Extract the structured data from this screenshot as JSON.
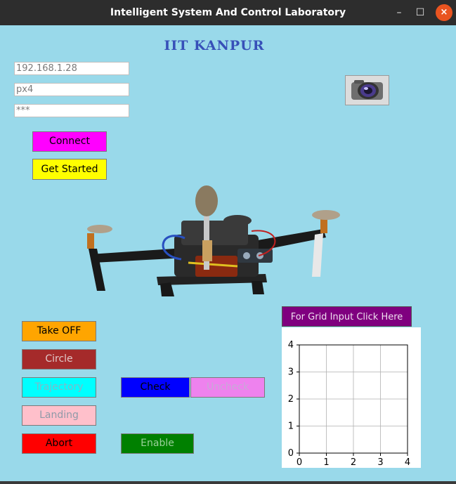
{
  "window": {
    "title": "Intelligent System And Control Laboratory"
  },
  "window_controls": {
    "minimize": "–",
    "maximize": "☐",
    "close": "×"
  },
  "heading": "IIT  KANPUR",
  "connection": {
    "ip": "192.168.1.28",
    "vehicle": "px4",
    "password": "***"
  },
  "buttons": {
    "connect": "Connect",
    "get_started": "Get Started",
    "take_off": "Take OFF",
    "circle": "Circle",
    "trajectory": "Trajectory",
    "check": "Check",
    "uncheck": "Uncheck",
    "landing": "Landing",
    "abort": "Abort",
    "enable": "Enable",
    "grid_input": "For Grid Input Click Here"
  },
  "colors": {
    "window_bg": "#99d9ea",
    "connect": "#ff00ff",
    "get_started": "#ffff00",
    "take_off": "#ffa500",
    "circle": "#a52a2a",
    "trajectory": "#00ffff",
    "check": "#0000ff",
    "uncheck": "#ee82ee",
    "landing": "#ffc0cb",
    "abort": "#ff0000",
    "enable": "#008000",
    "grid_input": "#800080"
  },
  "icons": {
    "camera": "camera-icon",
    "drone": "quadcopter-drone-image"
  },
  "chart_data": {
    "type": "scatter",
    "x_ticks": [
      "0",
      "1",
      "2",
      "3",
      "4"
    ],
    "y_ticks": [
      "0",
      "1",
      "2",
      "3",
      "4"
    ],
    "xlim": [
      0,
      4
    ],
    "ylim": [
      0,
      4
    ],
    "grid": true,
    "points": []
  }
}
